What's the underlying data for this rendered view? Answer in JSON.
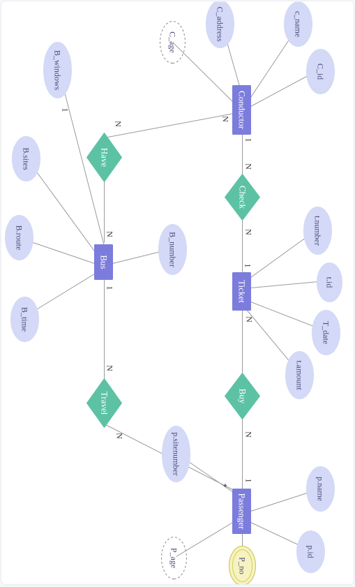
{
  "diagram_type": "entity-relationship",
  "entities": {
    "conductor": {
      "label": "Conductor",
      "attributes": {
        "c_id": "C_id",
        "c_name": "c_name",
        "c_address": "C_address",
        "c_age": "C_age"
      }
    },
    "ticket": {
      "label": "Ticket",
      "attributes": {
        "t_id": "t.id",
        "t_number": "t.number",
        "t_date": "T_date",
        "t_amount": "t.amount"
      }
    },
    "bus": {
      "label": "Bus",
      "attributes": {
        "b_number": "B_number",
        "b_windows": "B_windows",
        "b_sites": "B.sites",
        "b_route": "B.route",
        "b_time": "B_time"
      }
    },
    "passenger": {
      "label": "Passenger",
      "attributes": {
        "p_name": "p.name",
        "p_id": "p.id",
        "p_no": "P_no",
        "p_age": "P_age",
        "p_sitenumber": "p.sitenumber"
      }
    }
  },
  "relationships": {
    "check": {
      "label": "Check"
    },
    "have": {
      "label": "Have"
    },
    "buy": {
      "label": "Buy"
    },
    "travel": {
      "label": "Travel"
    }
  },
  "cardinalities": {
    "conductor_check": "1",
    "check_conductor_side": "N",
    "check_ticket_side": "N",
    "ticket_check": "1",
    "ticket_buy": "N",
    "buy_passenger": "N",
    "passenger_buy": "1",
    "passenger_travel_star": "*",
    "passenger_travel": "N",
    "travel_bus": "N",
    "bus_travel": "1",
    "bus_have": "N",
    "have_conductor": "N",
    "conductor_have": "N",
    "conductor_bwindows_side": "1"
  }
}
